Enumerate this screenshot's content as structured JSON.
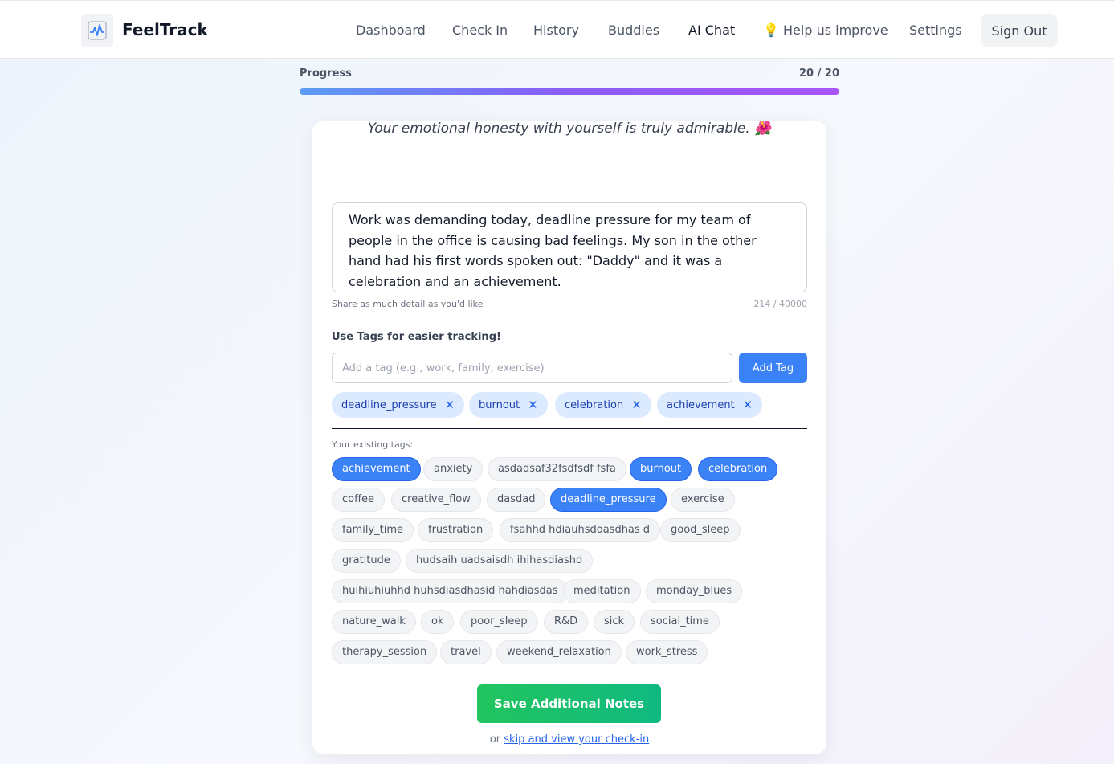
{
  "brand": {
    "name": "FeelTrack",
    "logo_icon": "pulse-chart-logo"
  },
  "nav": [
    {
      "label": "Dashboard",
      "active": false
    },
    {
      "label": "Check In",
      "active": false
    },
    {
      "label": "History",
      "active": false
    },
    {
      "label": "Buddies",
      "active": false
    },
    {
      "label": "AI Chat",
      "active": true
    },
    {
      "label": "💡 Help us improve",
      "active": false
    },
    {
      "label": "Settings",
      "active": false
    }
  ],
  "sign_out_label": "Sign Out",
  "progress": {
    "label": "Progress",
    "current": 20,
    "total": 20,
    "count_text": "20 / 20"
  },
  "card": {
    "quote": "Your emotional honesty with yourself is truly admirable. 🌺",
    "notes_text": "Work was demanding today, deadline pressure for my team of people in the office is causing bad feelings. My son in the other hand had his first words spoken out: \"Daddy\" and it was a celebration and an achievement.",
    "notes_hint": "Share as much detail as you'd like",
    "char_count": "214 / 40000",
    "tags_heading": "Use Tags for easier tracking!",
    "tag_input_placeholder": "Add a tag (e.g., work, family, exercise)",
    "add_tag_label": "Add Tag",
    "selected_tags": [
      "deadline_pressure",
      "burnout",
      "celebration",
      "achievement"
    ],
    "existing_label": "Your existing tags:",
    "existing_tags": [
      {
        "label": "achievement",
        "selected": true
      },
      {
        "label": "anxiety",
        "selected": false
      },
      {
        "label": "asdadsaf32fsdfsdf fsfa",
        "selected": false
      },
      {
        "label": "burnout",
        "selected": true
      },
      {
        "label": "celebration",
        "selected": true
      },
      {
        "label": "coffee",
        "selected": false
      },
      {
        "label": "creative_flow",
        "selected": false
      },
      {
        "label": "dasdad",
        "selected": false
      },
      {
        "label": "deadline_pressure",
        "selected": true
      },
      {
        "label": "exercise",
        "selected": false
      },
      {
        "label": "family_time",
        "selected": false
      },
      {
        "label": "frustration",
        "selected": false
      },
      {
        "label": "fsahhd hdiauhsdoasdhas d",
        "selected": false
      },
      {
        "label": "good_sleep",
        "selected": false
      },
      {
        "label": "gratitude",
        "selected": false
      },
      {
        "label": "hudsaih uadsaisdh ihihasdiashd",
        "selected": false
      },
      {
        "label": "huihiuhiuhhd huhsdiasdhasid hahdiasdas",
        "selected": false
      },
      {
        "label": "meditation",
        "selected": false
      },
      {
        "label": "monday_blues",
        "selected": false
      },
      {
        "label": "nature_walk",
        "selected": false
      },
      {
        "label": "ok",
        "selected": false
      },
      {
        "label": "poor_sleep",
        "selected": false
      },
      {
        "label": "R&D",
        "selected": false
      },
      {
        "label": "sick",
        "selected": false
      },
      {
        "label": "social_time",
        "selected": false
      },
      {
        "label": "therapy_session",
        "selected": false
      },
      {
        "label": "travel",
        "selected": false
      },
      {
        "label": "weekend_relaxation",
        "selected": false
      },
      {
        "label": "work_stress",
        "selected": false
      }
    ],
    "save_label": "Save Additional Notes",
    "skip_prefix": "or",
    "skip_link": "skip and view your check-in"
  },
  "colors": {
    "accent": "#3b82f6",
    "save": "#10b981",
    "chip_bg": "#dbeafe"
  }
}
